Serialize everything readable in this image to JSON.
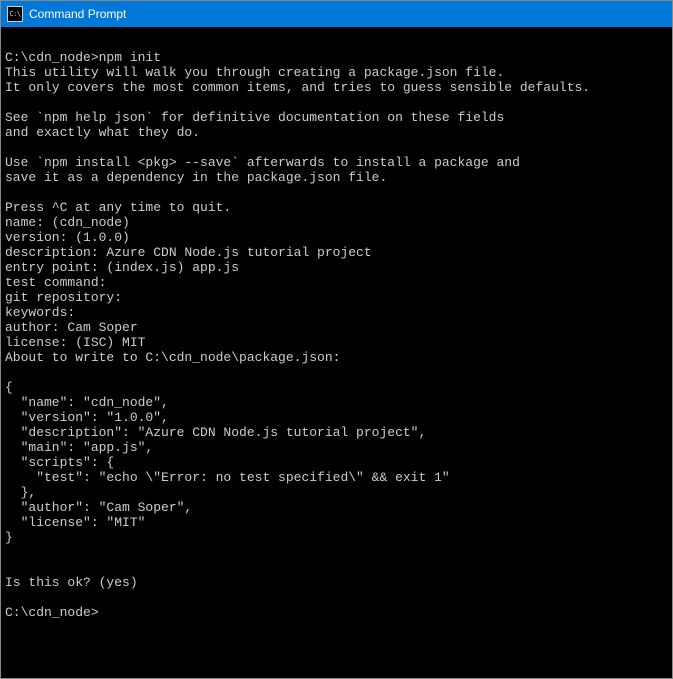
{
  "window": {
    "title": "Command Prompt",
    "icon_text": "C:\\"
  },
  "terminal": {
    "lines": [
      "",
      "C:\\cdn_node>npm init",
      "This utility will walk you through creating a package.json file.",
      "It only covers the most common items, and tries to guess sensible defaults.",
      "",
      "See `npm help json` for definitive documentation on these fields",
      "and exactly what they do.",
      "",
      "Use `npm install <pkg> --save` afterwards to install a package and",
      "save it as a dependency in the package.json file.",
      "",
      "Press ^C at any time to quit.",
      "name: (cdn_node)",
      "version: (1.0.0)",
      "description: Azure CDN Node.js tutorial project",
      "entry point: (index.js) app.js",
      "test command:",
      "git repository:",
      "keywords:",
      "author: Cam Soper",
      "license: (ISC) MIT",
      "About to write to C:\\cdn_node\\package.json:",
      "",
      "{",
      "  \"name\": \"cdn_node\",",
      "  \"version\": \"1.0.0\",",
      "  \"description\": \"Azure CDN Node.js tutorial project\",",
      "  \"main\": \"app.js\",",
      "  \"scripts\": {",
      "    \"test\": \"echo \\\"Error: no test specified\\\" && exit 1\"",
      "  },",
      "  \"author\": \"Cam Soper\",",
      "  \"license\": \"MIT\"",
      "}",
      "",
      "",
      "Is this ok? (yes)",
      "",
      "C:\\cdn_node>"
    ]
  }
}
